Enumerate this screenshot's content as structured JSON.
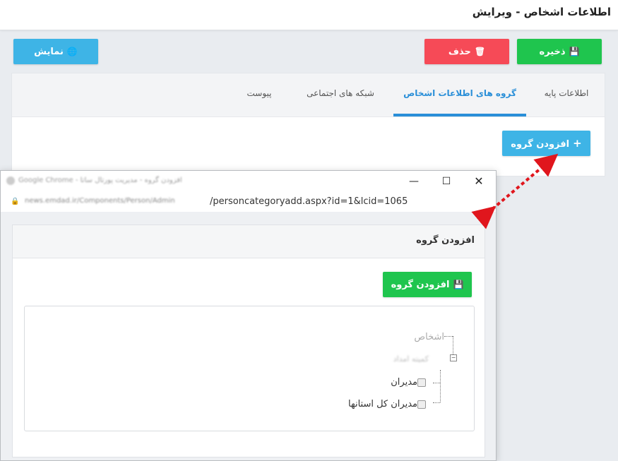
{
  "page_title": "اطلاعات اشخاص - ویرایش",
  "toolbar": {
    "save_label": "ذخیره",
    "delete_label": "حذف",
    "show_label": "نمایش"
  },
  "tabs": [
    {
      "label": "اطلاعات پایه",
      "active": false
    },
    {
      "label": "گروه های اطلاعات اشخاص",
      "active": true
    },
    {
      "label": "شبکه های اجتماعی",
      "active": false
    },
    {
      "label": "پیوست",
      "active": false
    }
  ],
  "add_group_label": "افزودن گروه",
  "popup": {
    "window_title": "افزودن گروه - مدیریت پورتال ساتا - Google Chrome",
    "url_prefix": "news.emdad.ir/Components/Person/Admin",
    "url_path": "/personcategoryadd.aspx?id=1&lcid=1065",
    "panel_title": "افزودن گروه",
    "submit_label": "افزودن گروه",
    "tree": {
      "root": "اشخاص",
      "child": "کمیته امداد",
      "items": [
        "مدیران",
        "مدیران کل استانها"
      ]
    }
  },
  "colors": {
    "green": "#1fc54e",
    "red": "#f64a57",
    "blue": "#3eb4e6",
    "active_tab": "#2a8fd8",
    "arrow": "#e0161d"
  }
}
